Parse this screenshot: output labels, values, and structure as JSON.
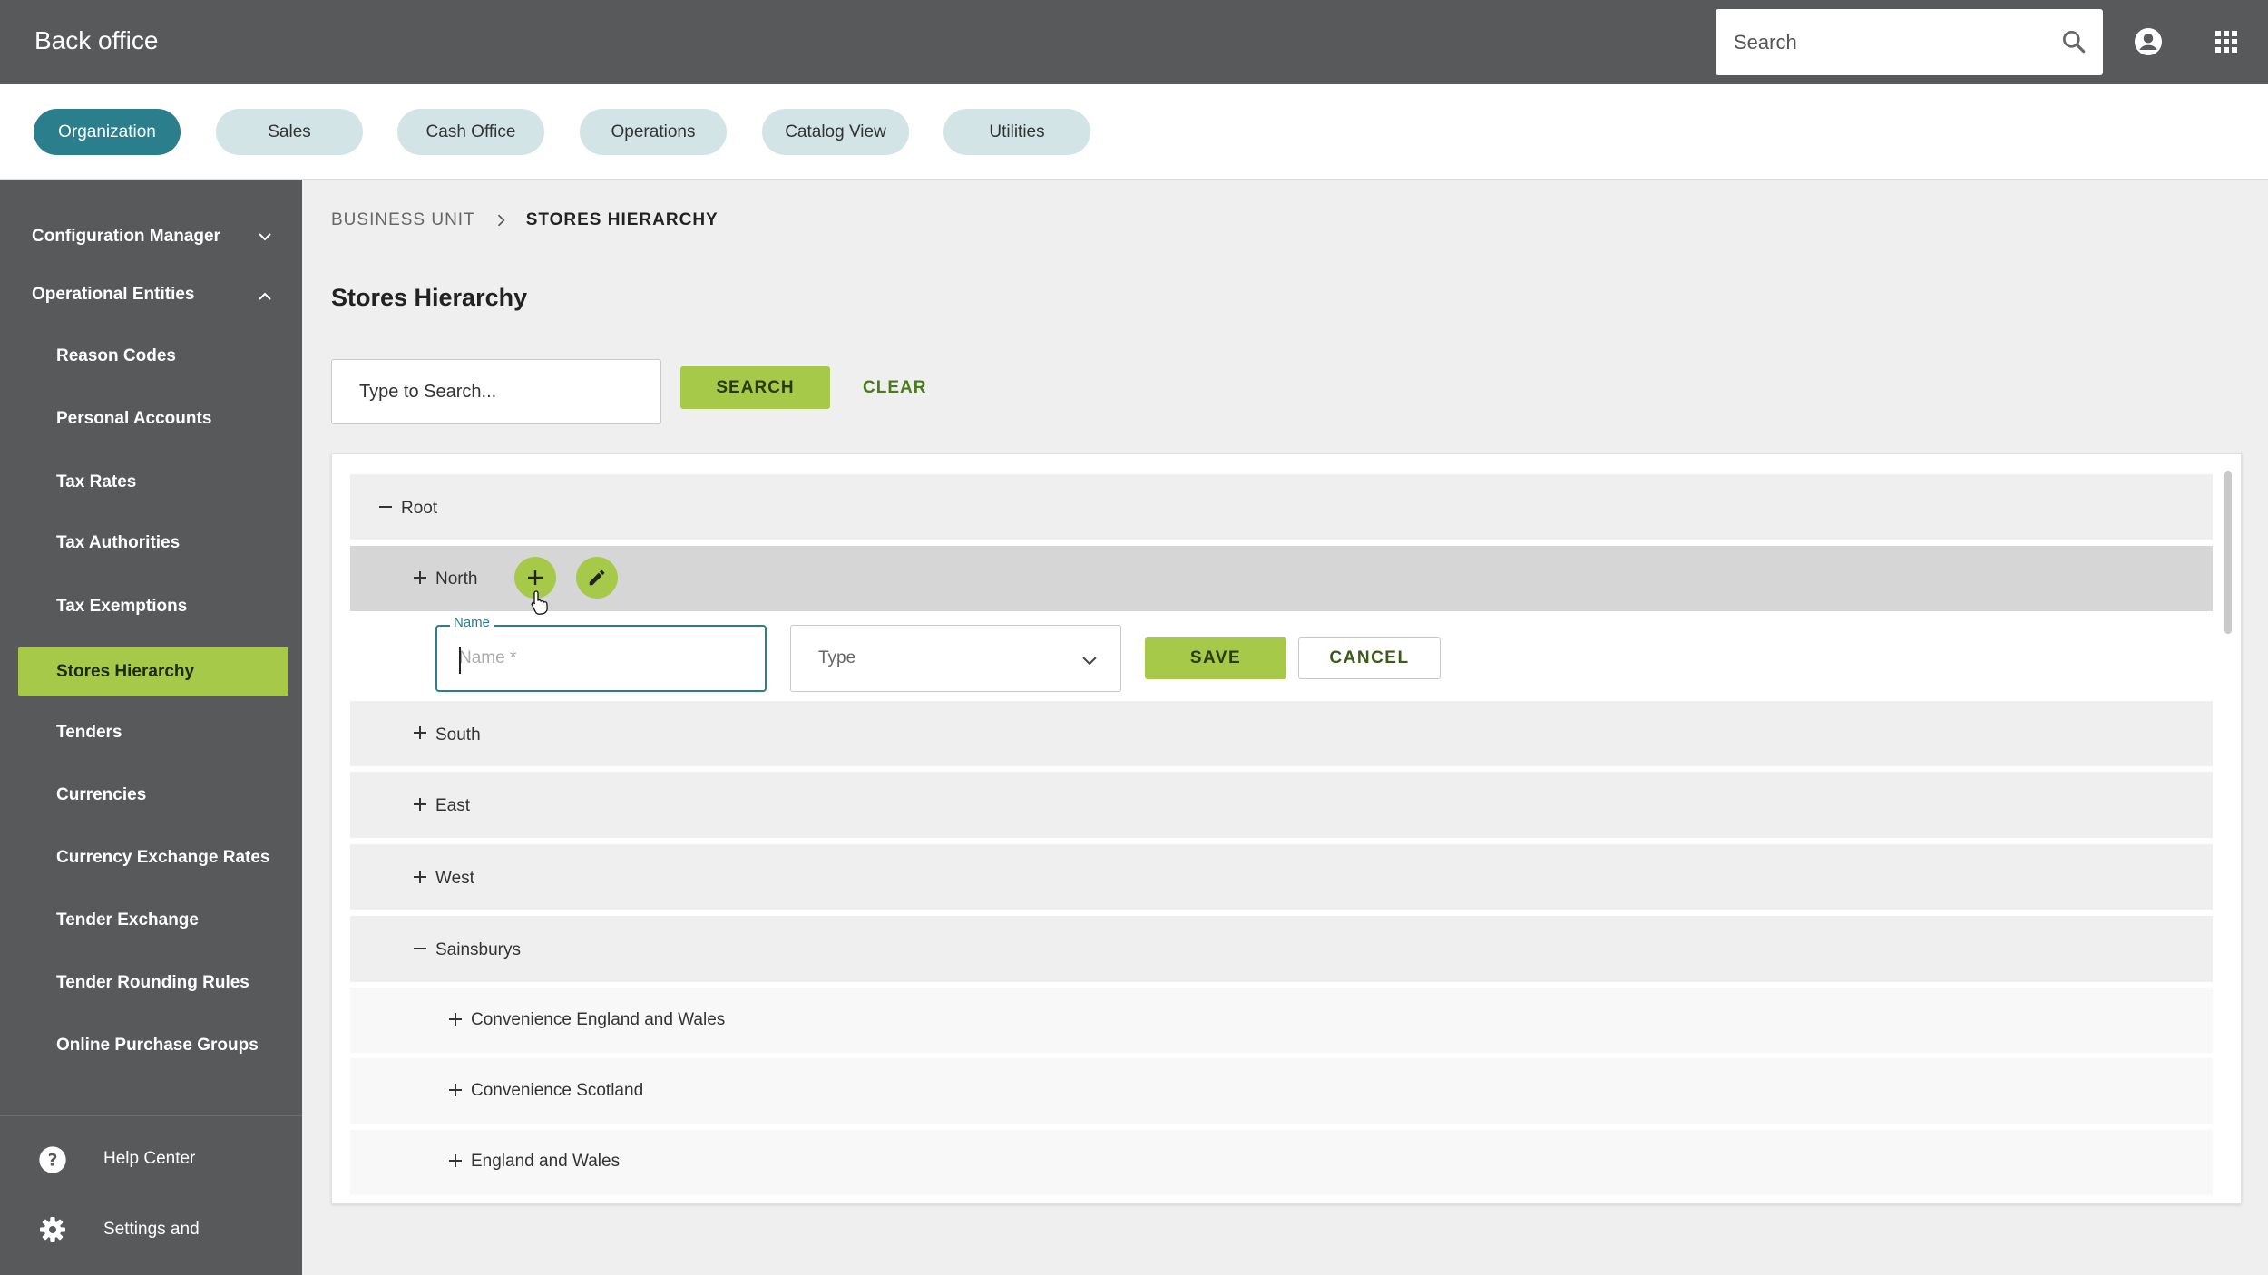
{
  "app": {
    "title": "Back office"
  },
  "header": {
    "search_placeholder": "Search",
    "icons": [
      "search-icon",
      "account-icon",
      "apps-grid-icon"
    ]
  },
  "modules": [
    {
      "label": "Organization",
      "active": true
    },
    {
      "label": "Sales",
      "active": false
    },
    {
      "label": "Cash Office",
      "active": false
    },
    {
      "label": "Operations",
      "active": false
    },
    {
      "label": "Catalog View",
      "active": false
    },
    {
      "label": "Utilities",
      "active": false
    }
  ],
  "sidebar": {
    "groups": [
      {
        "label": "Configuration Manager",
        "expanded": false
      },
      {
        "label": "Operational Entities",
        "expanded": true
      }
    ],
    "items": [
      {
        "label": "Reason Codes"
      },
      {
        "label": "Personal Accounts"
      },
      {
        "label": "Tax Rates"
      },
      {
        "label": "Tax Authorities"
      },
      {
        "label": "Tax Exemptions"
      },
      {
        "label": "Stores Hierarchy",
        "active": true
      },
      {
        "label": "Tenders"
      },
      {
        "label": "Currencies"
      },
      {
        "label": "Currency Exchange Rates"
      },
      {
        "label": "Tender Exchange"
      },
      {
        "label": "Tender Rounding Rules"
      },
      {
        "label": "Online Purchase Groups"
      }
    ],
    "footer": [
      {
        "label": "Help Center",
        "icon": "help-circle-icon"
      },
      {
        "label": "Settings and",
        "icon": "gear-icon"
      }
    ]
  },
  "breadcrumb": {
    "parent": "BUSINESS UNIT",
    "current": "STORES HIERARCHY"
  },
  "page": {
    "title": "Stores Hierarchy",
    "search_placeholder": "Type to Search...",
    "search_button": "SEARCH",
    "clear_button": "CLEAR"
  },
  "tree": {
    "nodes": [
      {
        "label": "Root",
        "expanded": true
      },
      {
        "label": "North",
        "expanded": false
      },
      {
        "label": "South",
        "expanded": false
      },
      {
        "label": "East",
        "expanded": false
      },
      {
        "label": "West",
        "expanded": false
      },
      {
        "label": "Sainsburys",
        "expanded": true
      },
      {
        "label": "Convenience England and Wales",
        "expanded": false
      },
      {
        "label": "Convenience Scotland",
        "expanded": false
      },
      {
        "label": "England and Wales",
        "expanded": false
      }
    ]
  },
  "new_node_form": {
    "name_label": "Name",
    "name_placeholder": "Name *",
    "type_placeholder": "Type",
    "save_button": "SAVE",
    "cancel_button": "CANCEL"
  },
  "colors": {
    "header_bg": "#58595b",
    "accent_teal": "#2b7f8c",
    "accent_green": "#a6c94a"
  }
}
